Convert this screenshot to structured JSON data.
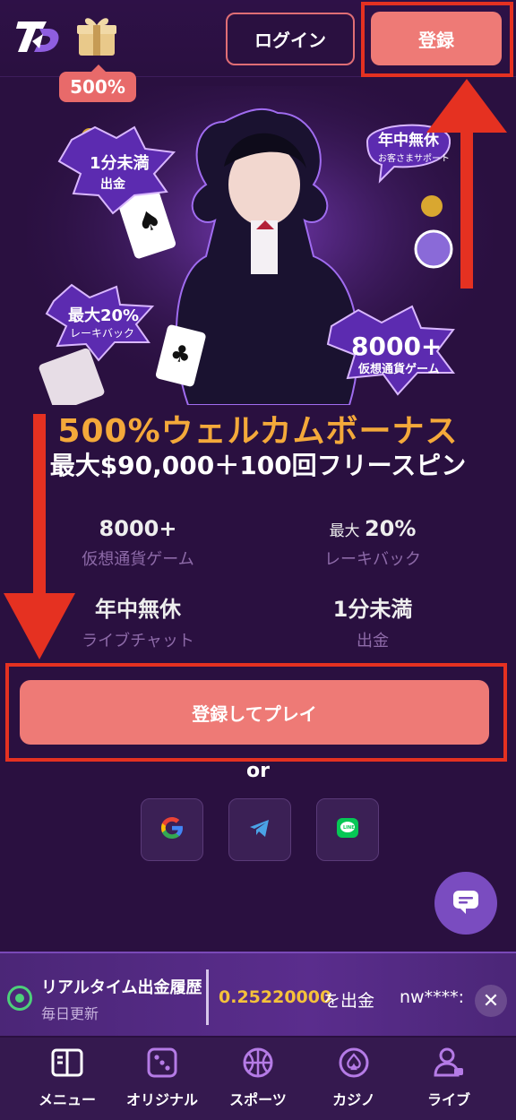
{
  "header": {
    "promo_badge": "500%",
    "login_label": "ログイン",
    "register_label": "登録"
  },
  "hero": {
    "badges": {
      "top_left_line1": "1分未満",
      "top_left_line2": "出金",
      "top_right_line1": "年中無休",
      "top_right_line2": "お客さまサポート",
      "mid_left_line1": "最大20%",
      "mid_left_line2": "レーキバック",
      "mid_right_line1": "8000+",
      "mid_right_line2": "仮想通貨ゲーム"
    }
  },
  "welcome": {
    "title": "500%ウェルカムボーナス",
    "subtitle": "最大$90,000＋100回フリースピン"
  },
  "stats": [
    {
      "prefix": "",
      "value": "8000+",
      "label": "仮想通貨ゲーム"
    },
    {
      "prefix": "最大 ",
      "value": "20%",
      "label": "レーキバック"
    },
    {
      "prefix": "",
      "value": "年中無休",
      "label": "ライブチャット"
    },
    {
      "prefix": "",
      "value": "1分未満",
      "label": "出金"
    }
  ],
  "cta": {
    "label": "登録してプレイ",
    "or_text": "or"
  },
  "social": [
    "google-icon",
    "telegram-icon",
    "line-icon"
  ],
  "ticker": {
    "title": "リアルタイム出金履歴",
    "subtitle": "毎日更新",
    "amount": "0.25220000",
    "amount_suffix": "を出金",
    "user": "nw****:",
    "close": "✕"
  },
  "nav": [
    {
      "label": "メニュー",
      "icon": "menu-icon"
    },
    {
      "label": "オリジナル",
      "icon": "dice-icon"
    },
    {
      "label": "スポーツ",
      "icon": "basketball-icon"
    },
    {
      "label": "カジノ",
      "icon": "spade-icon"
    },
    {
      "label": "ライブ",
      "icon": "live-dealer-icon"
    }
  ],
  "colors": {
    "background": "#2a1040",
    "accent": "#ee7a76",
    "title": "#f4a93a",
    "annotation_red": "#e53121"
  }
}
